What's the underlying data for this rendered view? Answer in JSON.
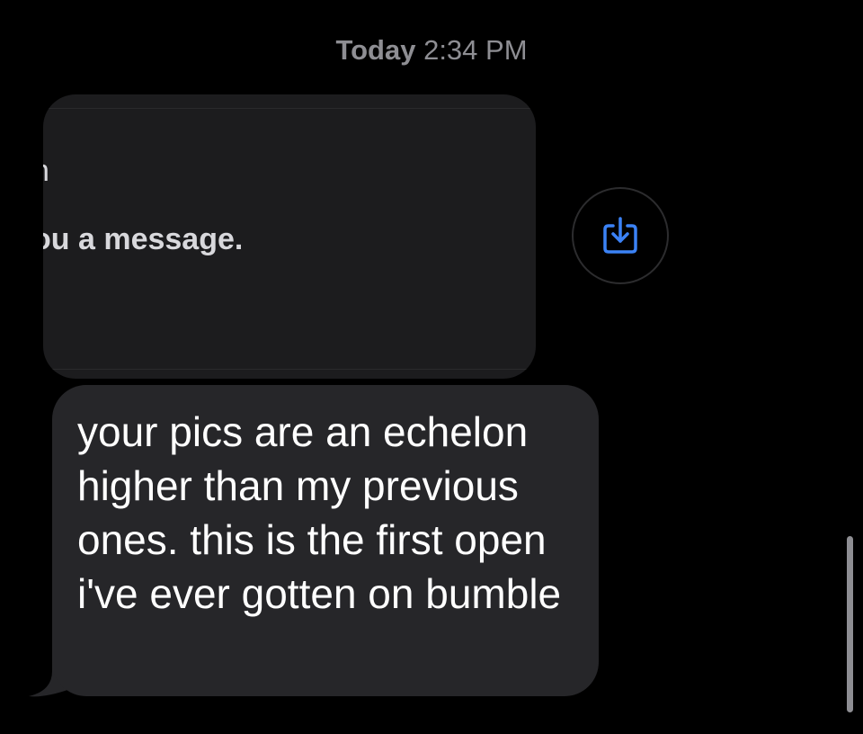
{
  "conversation": {
    "timestamp": {
      "day": "Today",
      "time": "2:34 PM"
    },
    "image_message": {
      "snippet_line_1": "n",
      "snippet_line_2": "ou a message."
    },
    "save_button": {
      "icon": "square-arrow-down-icon",
      "accent_color": "#3b82f6"
    },
    "text_message": {
      "body": "your pics are an echelon higher than my previous ones. this is the first open i've ever gotten on bumble"
    }
  },
  "colors": {
    "background": "#000000",
    "incoming_bubble": "#262629",
    "image_bubble": "#1c1c1e",
    "timestamp": "#8e8e93",
    "message_text": "#ffffff"
  }
}
